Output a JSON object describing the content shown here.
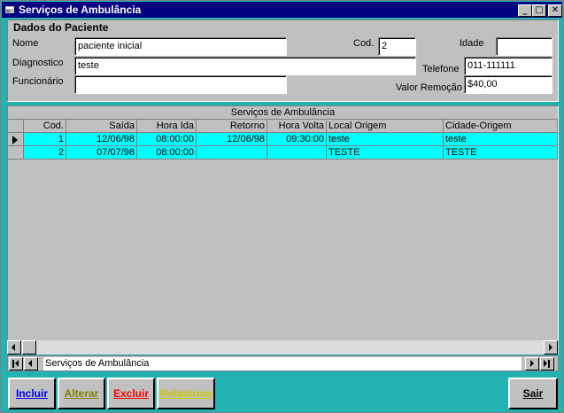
{
  "window": {
    "title": "Serviços de Ambulância",
    "controls": {
      "minimize": "_",
      "maximize": "□",
      "close": "✕"
    }
  },
  "patient_panel": {
    "group_title": "Dados do Paciente",
    "labels": {
      "nome": "Nome",
      "diagnostico": "Diagnostico",
      "funcionario": "Funcionário",
      "cod": "Cod.",
      "idade": "Idade",
      "telefone": "Telefone",
      "valor_remocao": "Valor Remoção"
    },
    "values": {
      "nome": "paciente inicial",
      "diagnostico": "teste",
      "funcionario": "",
      "cod": "2",
      "idade": "",
      "telefone": "011-111111",
      "valor_remocao": "$40,00"
    }
  },
  "grid": {
    "caption": "Serviços de Ambulância",
    "columns": [
      "Cod.",
      "Saída",
      "Hora Ida",
      "Retorno",
      "Hora Volta",
      "Local Origem",
      "Cidade-Origem"
    ],
    "rows": [
      [
        "1",
        "12/06/98",
        "08:00:00",
        "12/06/98",
        "09:30:00",
        "teste",
        "teste"
      ],
      [
        "2",
        "07/07/98",
        "08:00:00",
        "",
        "",
        "TESTE",
        "TESTE"
      ]
    ]
  },
  "navigator": {
    "caption": "Serviços de Ambulância"
  },
  "buttons": {
    "incluir": "Incluir",
    "alterar": "Alterar",
    "excluir": "Excluir",
    "relatorios": "Relatórios",
    "sair": "Sair"
  },
  "colors": {
    "background": "#22b2b2",
    "titlebar": "#000080",
    "row_highlight": "#00ffff",
    "incluir": "#0000ff",
    "alterar": "#808000",
    "excluir": "#ff0000",
    "relatorios": "#c8c800",
    "sair": "#000000"
  }
}
